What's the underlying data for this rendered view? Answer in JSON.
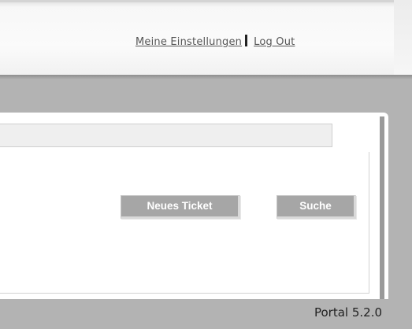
{
  "header": {
    "settings_link": "Meine Einstellungen",
    "logout_link": "Log Out"
  },
  "toolbar": {
    "new_ticket_label": "Neues Ticket",
    "search_label": "Suche"
  },
  "search": {
    "value": ""
  },
  "footer": {
    "version": "Portal 5.2.0"
  },
  "colors": {
    "background": "#b3b3b3",
    "button": "#a6a6a6",
    "link": "#555555"
  }
}
